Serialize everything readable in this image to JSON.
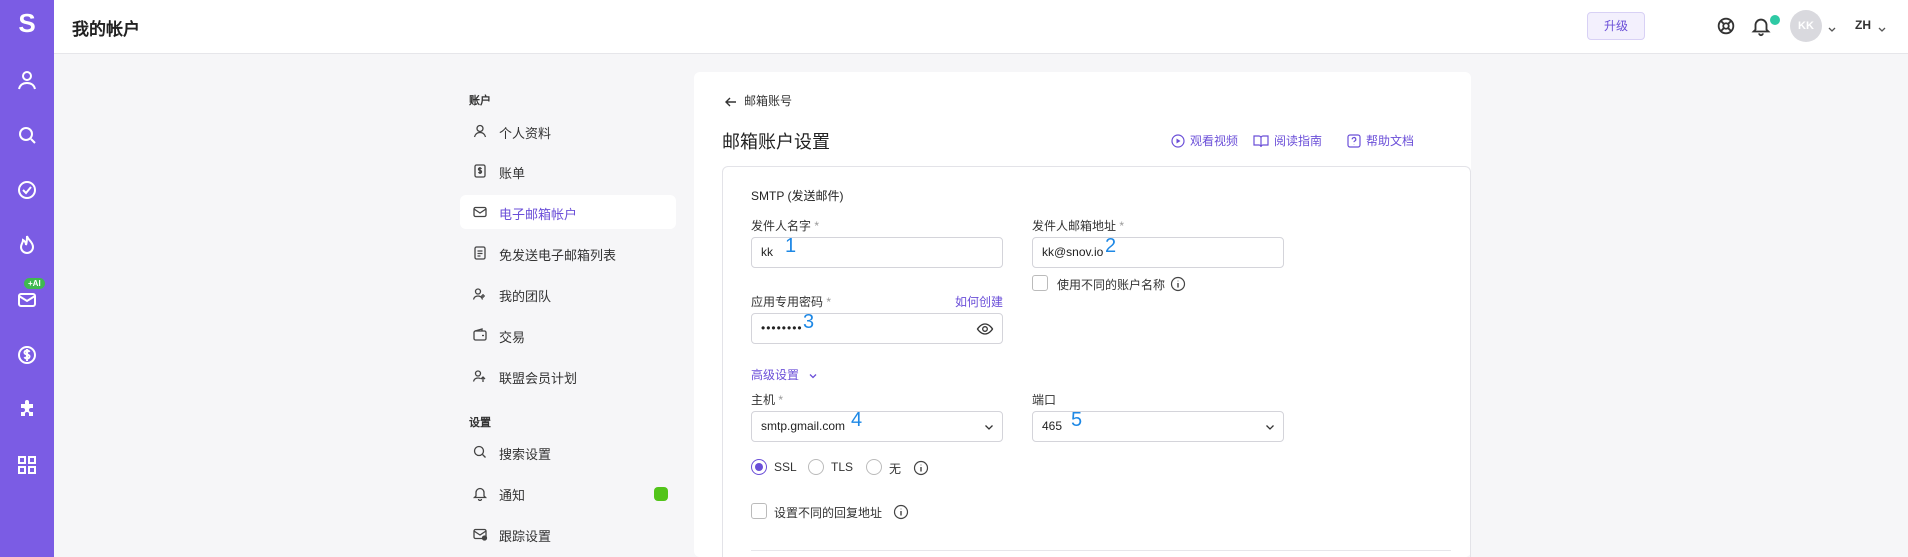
{
  "app": {
    "logo": "S",
    "rail_badge": "+AI",
    "page_title": "我的帐户",
    "upgrade_label": "升级",
    "avatar_initials": "KK",
    "language": "ZH",
    "accent": "#7b5ce4"
  },
  "nav": {
    "section_account": "账户",
    "section_settings": "设置",
    "items": [
      {
        "label": "个人资料",
        "icon": "user-icon"
      },
      {
        "label": "账单",
        "icon": "billing-icon"
      },
      {
        "label": "电子邮箱帐户",
        "icon": "mail-icon",
        "active": true
      },
      {
        "label": "免发送电子邮箱列表",
        "icon": "list-icon"
      },
      {
        "label": "我的团队",
        "icon": "team-icon"
      },
      {
        "label": "交易",
        "icon": "wallet-icon"
      },
      {
        "label": "联盟会员计划",
        "icon": "affiliate-icon"
      },
      {
        "label": "搜索设置",
        "icon": "search-icon"
      },
      {
        "label": "通知",
        "icon": "bell-icon"
      },
      {
        "label": "跟踪设置",
        "icon": "tracking-icon"
      }
    ]
  },
  "card": {
    "back_label": "邮箱账号",
    "title": "邮箱账户设置",
    "watch_video": "观看视频",
    "read_guide": "阅读指南",
    "help_docs": "帮助文档"
  },
  "smtp": {
    "section_title": "SMTP (发送邮件)",
    "sender_name_label": "发件人名字",
    "sender_name_value": "kk",
    "sender_email_label": "发件人邮箱地址",
    "sender_email_value": "kk@snov.io",
    "different_account_name": "使用不同的账户名称",
    "app_password_label": "应用专用密码",
    "how_to_create": "如何创建",
    "password_value": "••••••••",
    "advanced_settings": "高级设置",
    "host_label": "主机",
    "host_value": "smtp.gmail.com",
    "port_label": "端口",
    "port_value": "465",
    "ssl": "SSL",
    "tls": "TLS",
    "none": "无",
    "different_reply": "设置不同的回复地址",
    "required_mark": "*",
    "annotations": [
      "1",
      "2",
      "3",
      "4",
      "5"
    ]
  }
}
